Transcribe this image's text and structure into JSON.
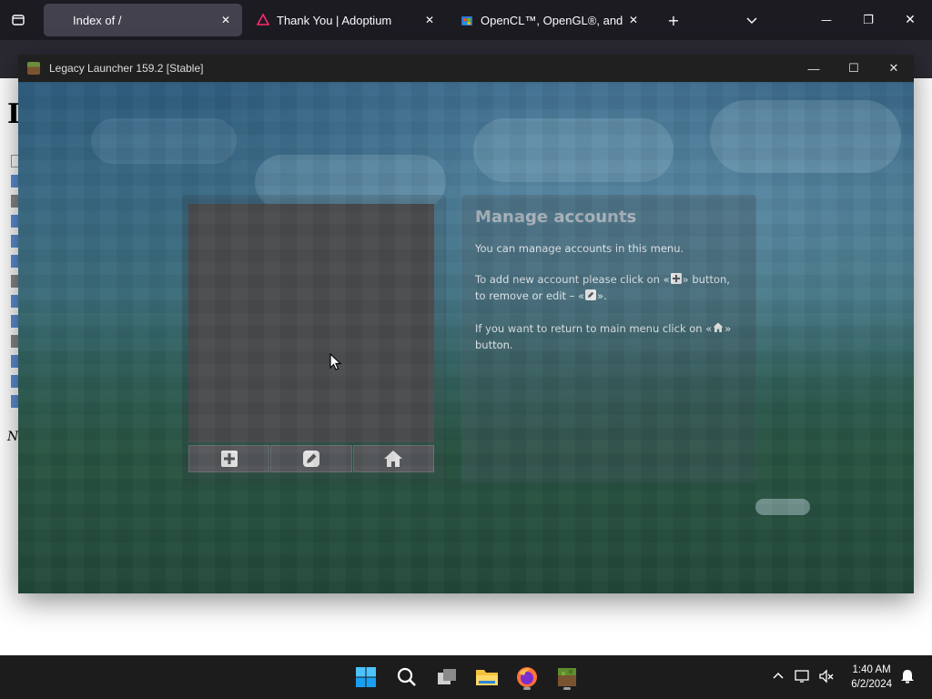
{
  "browser": {
    "tabs": [
      {
        "title": "Index of /",
        "active": true,
        "favicon": "page-icon"
      },
      {
        "title": "Thank You | Adoptium",
        "active": false,
        "favicon": "adoptium-icon"
      },
      {
        "title": "OpenCL™, OpenGL®, and Vulk",
        "active": false,
        "favicon": "microsoft-store-icon"
      }
    ],
    "new_tab_label": "+",
    "window_controls": {
      "minimize": "—",
      "maximize": "❐",
      "close": "✕"
    }
  },
  "webpage": {
    "heading": "I",
    "footer": "N"
  },
  "launcher": {
    "window_title": "Legacy Launcher 159.2 [Stable]",
    "controls": {
      "minimize": "—",
      "maximize": "☐",
      "close": "✕"
    },
    "manage": {
      "title": "Manage accounts",
      "intro": "You can manage accounts in this menu.",
      "add_text_1": "To add new account please click on «",
      "add_text_2": "» button, to remove or edit – «",
      "add_text_3": "».",
      "return_text_1": "If you want to return to main menu click on «",
      "return_text_2": "» button."
    },
    "buttons": [
      "add-icon",
      "edit-icon",
      "home-icon"
    ]
  },
  "taskbar": {
    "apps": [
      "windows-start-icon",
      "search-icon",
      "task-view-icon",
      "file-explorer-icon",
      "firefox-icon",
      "minecraft-launcher-icon"
    ],
    "time": "1:40 AM",
    "date": "6/2/2024"
  }
}
